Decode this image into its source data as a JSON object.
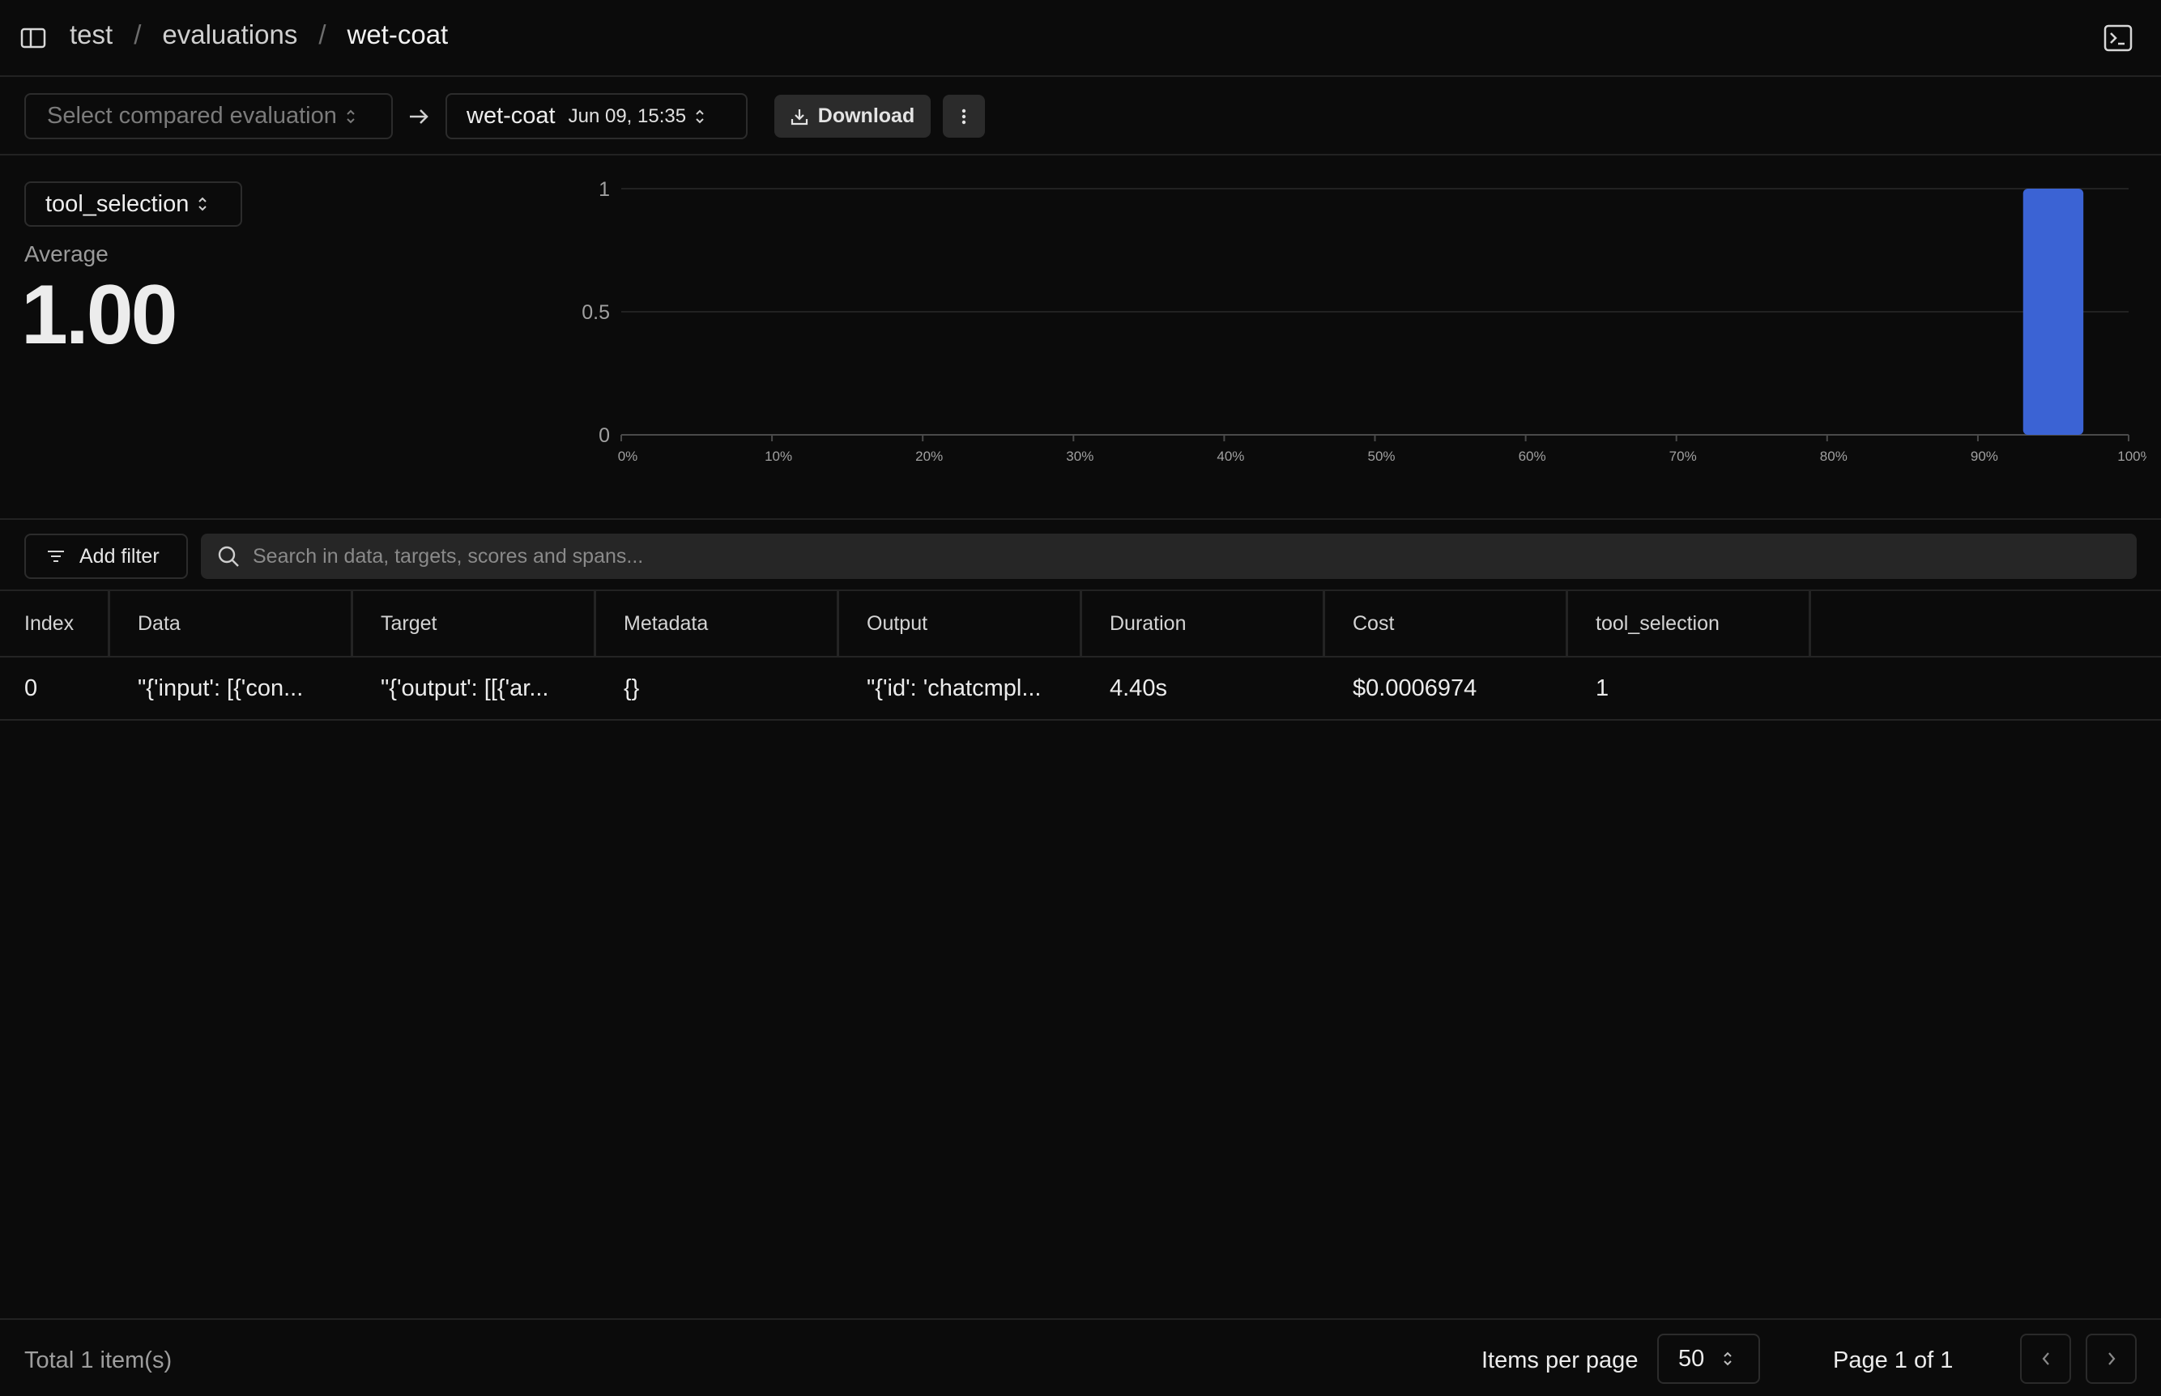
{
  "breadcrumb": [
    "test",
    "evaluations",
    "wet-coat"
  ],
  "toolbar": {
    "compare_placeholder": "Select compared evaluation",
    "evaluation_name": "wet-coat",
    "evaluation_date": "Jun 09, 15:35",
    "download_label": "Download"
  },
  "score": {
    "selected": "tool_selection",
    "average_label": "Average",
    "average_value": "1.00"
  },
  "chart_data": {
    "type": "bar",
    "title": "",
    "xlabel": "",
    "ylabel": "",
    "x_ticks": [
      "0%",
      "10%",
      "20%",
      "30%",
      "40%",
      "50%",
      "60%",
      "70%",
      "80%",
      "90%",
      "100%"
    ],
    "y_ticks": [
      "0",
      "0.5",
      "1"
    ],
    "ylim": [
      0,
      1
    ],
    "xlim": [
      0,
      100
    ],
    "bins": [
      {
        "from": 93,
        "to": 97,
        "value": 1
      }
    ],
    "bar_color": "#3b63d4",
    "grid": true
  },
  "filter": {
    "add_filter_label": "Add filter",
    "search_placeholder": "Search in data, targets, scores and spans..."
  },
  "table": {
    "columns": [
      "Index",
      "Data",
      "Target",
      "Metadata",
      "Output",
      "Duration",
      "Cost",
      "tool_selection"
    ],
    "rows": [
      [
        "0",
        "\"{'input': [{'con...",
        "\"{'output': [[{'ar...",
        "{}",
        "\"{'id': 'chatcmpl...",
        "4.40s",
        "$0.0006974",
        "1"
      ]
    ]
  },
  "footer": {
    "total": "Total 1 item(s)",
    "items_per_page_label": "Items per page",
    "items_per_page": "50",
    "page": "Page 1 of 1"
  }
}
